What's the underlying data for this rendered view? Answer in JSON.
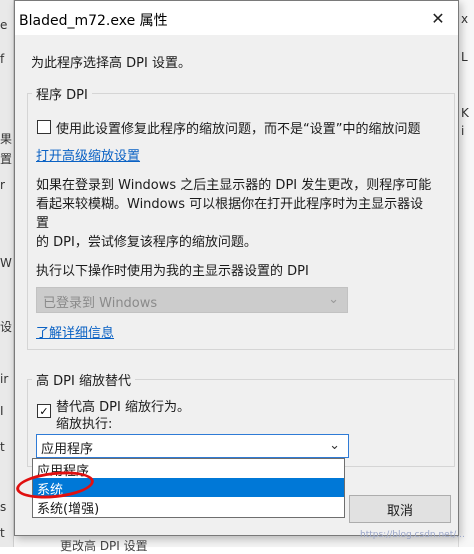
{
  "dialog": {
    "title": "Bladed_m72.exe 属性",
    "close_glyph": "✕",
    "intro": "为此程序选择高 DPI 设置。"
  },
  "program_dpi": {
    "legend": "程序 DPI",
    "checkbox_label": "使用此设置修复此程序的缩放问题，而不是“设置”中的缩放问题",
    "checkbox_checked": false,
    "advanced_link": "打开高级缩放设置",
    "description_lines": [
      "如果在登录到 Windows 之后主显示器的 DPI 发生更改，则程序可能",
      "看起来较模糊。Windows 可以根据你在打开此程序时为主显示器设置",
      "的 DPI，尝试修复该程序的缩放问题。"
    ],
    "select_label": "执行以下操作时使用为我的主显示器设置的 DPI",
    "select_value": "已登录到 Windows",
    "learn_more_link": "了解详细信息"
  },
  "high_dpi": {
    "legend": "高 DPI 缩放替代",
    "checkbox_label": "替代高 DPI 缩放行为。",
    "checkbox_checked": true,
    "sub_label": "缩放执行:",
    "select_value": "应用程序",
    "options": [
      "应用程序",
      "系统",
      "系统(增强)"
    ],
    "highlighted_index": 1
  },
  "buttons": {
    "cancel": "取消"
  },
  "background": {
    "left_glyphs": [
      "e",
      "f",
      "果",
      "置",
      "r",
      "W",
      "设",
      "ir",
      "I",
      "t",
      "s",
      "t"
    ],
    "right_glyphs": [
      "x",
      "L",
      "K",
      "i"
    ],
    "footer_text": "更改高 DPI 设置",
    "watermark": "https://blog.csdn.net/..."
  },
  "colors": {
    "accent": "#0078d7",
    "link": "#0b62c4",
    "annotation": "#e01010"
  }
}
